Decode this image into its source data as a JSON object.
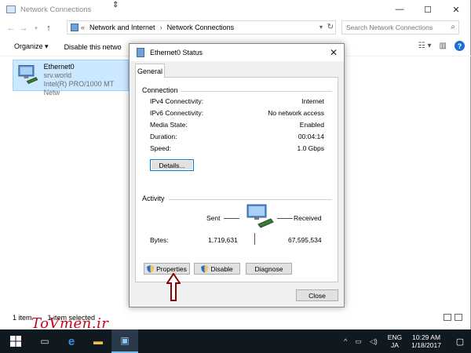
{
  "explorer": {
    "title": "Network Connections",
    "address": {
      "crumbs": [
        "Network and Internet",
        "Network Connections"
      ],
      "overflow": "«"
    },
    "search_placeholder": "Search Network Connections",
    "commands": [
      "Organize",
      "Disable this netwo"
    ],
    "item": {
      "name": "Ethernet0",
      "network": "srv.world",
      "adapter": "Intel(R) PRO/1000 MT Netw"
    },
    "status": {
      "count": "1 item",
      "selected": "1 item selected"
    }
  },
  "dialog": {
    "title": "Ethernet0 Status",
    "tab": "General",
    "connection_label": "Connection",
    "connection_rows": [
      {
        "label": "IPv4 Connectivity:",
        "value": "Internet"
      },
      {
        "label": "IPv6 Connectivity:",
        "value": "No network access"
      },
      {
        "label": "Media State:",
        "value": "Enabled"
      },
      {
        "label": "Duration:",
        "value": "00:04:14"
      },
      {
        "label": "Speed:",
        "value": "1.0 Gbps"
      }
    ],
    "details_button": "Details...",
    "activity": {
      "label": "Activity",
      "sent_label": "Sent",
      "received_label": "Received",
      "bytes_label": "Bytes:",
      "bytes_sent": "1,719,631",
      "bytes_received": "67,595,534"
    },
    "buttons": {
      "properties": "Properties",
      "disable": "Disable",
      "diagnose": "Diagnose",
      "close": "Close"
    }
  },
  "watermark": "ToVmen.ir",
  "taskbar": {
    "language": "ENG",
    "ime": "JA",
    "time": "10:29 AM",
    "date": "1/18/2017"
  },
  "colors": {
    "accent": "#0078d7",
    "selection": "#cce8ff",
    "annotation": "#8b0000"
  }
}
